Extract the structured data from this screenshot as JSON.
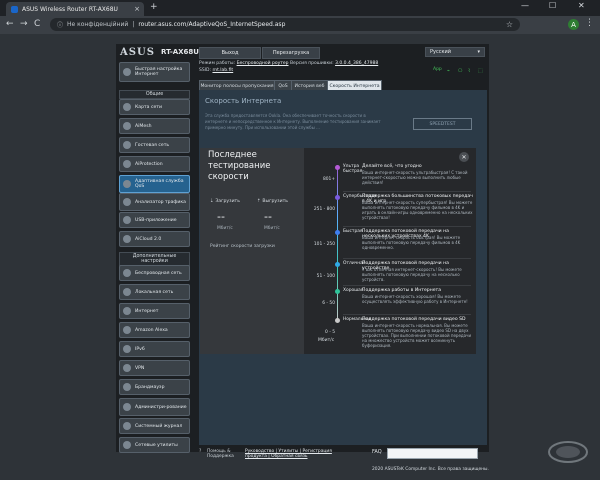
{
  "browser": {
    "tab_title": "ASUS Wireless Router RT-AX68U",
    "tab_close": "×",
    "new_tab": "+",
    "window_controls": [
      "—",
      "☐",
      "✕"
    ],
    "nav_back": "←",
    "nav_forward": "→",
    "nav_reload": "C",
    "not_secure": "Не конфіденційний",
    "url": "router.asus.com/AdaptiveQoS_InternetSpeed.asp",
    "avatar_letter": "A",
    "menu": "⋮"
  },
  "router": {
    "brand": "ASUS",
    "model": "RT-AX68U",
    "logout": "Выход",
    "reboot": "Перезагрузка",
    "language": "Русский",
    "mode_label": "Режим работы:",
    "mode_value": "Беспроводной роутер",
    "fw_label": "Версия прошивки:",
    "fw_value": "3.0.0.4_386_47988",
    "ssid_label": "SSID:",
    "ssid_value": "rnt.lab.fit",
    "app_label": "App"
  },
  "sidebar": {
    "quick_setup": "Быстрая настройка Интернет",
    "general_header": "Общие",
    "general": [
      "Карта сети",
      "AiMesh",
      "Гостевая сеть",
      "AiProtection",
      "Адаптивная служба QoS",
      "Анализатор трафика",
      "USB-приложение",
      "AiCloud 2.0"
    ],
    "advanced_header": "Дополнительные настройки",
    "advanced": [
      "Беспроводная сеть",
      "Локальная сеть",
      "Интернет",
      "Amazon Alexa",
      "IPv6",
      "VPN",
      "Брандмауэр",
      "Администри-рование",
      "Системный журнал",
      "Сетевые утилиты"
    ]
  },
  "tabs": [
    "Монитор полосы пропускания",
    "QoS",
    "История веб",
    "Скорость Интернета"
  ],
  "content": {
    "title": "Скорость Интернета",
    "desc": "Эта служба предоставляется Ookla. Она обеспечивает точность скорости в интернете и непосредственное к Интернету. Выполнение тестирования занимает примерно минуту. При использовании этой службы ...",
    "ookla": "SPEEDTEST"
  },
  "modal": {
    "title": "Последнее тестирование скорости",
    "close": "✕",
    "download_label": "Загрузить",
    "upload_label": "Выгрузить",
    "download_value": "--",
    "upload_value": "--",
    "unit": "Мбит/с",
    "rating": "Рейтинг скорости загрузки",
    "axis_unit": "Мбит/с",
    "levels": [
      {
        "range": "801+",
        "name": "Ультра быстрая",
        "title": "Делайте всё, что угодно",
        "desc": "Ваша интернет-скорость ультрабыстрая! С такой интернет-скоростью можно выполнить любые действия!",
        "color": "#b45ad6"
      },
      {
        "range": "251 - 800",
        "name": "Супербыстрая",
        "title": "Поддержка большинства потоковых передач в 4K и игр",
        "desc": "Ваша интернет-скорость супербыстрая! Вы можете выполнять потоковую передачу фильмов в 4K и играть в онлайн-игры одновременно на нескольких устройствах!",
        "color": "#7b5be0"
      },
      {
        "range": "101 - 250",
        "name": "Быстрая",
        "title": "Поддержка потоковой передачи на нескольких устройствах 4K",
        "desc": "Ваша интернет-скорость быстрая! Вы можете выполнять потоковую передачу фильмов в 4K одновременно.",
        "color": "#3f7ef0"
      },
      {
        "range": "51 - 100",
        "name": "Отличная",
        "title": "Поддержка потоковой передачи на устройстве",
        "desc": "У вас отличная интернет-скорость! Вы можете выполнять потоковую передачу на несколько устройств.",
        "color": "#2fa9e6"
      },
      {
        "range": "6 - 50",
        "name": "Хорошая",
        "title": "Поддержка работы в Интернета",
        "desc": "Ваша интернет-скорость хорошая! Вы можете осуществлять эффективную работу в Интернете!",
        "color": "#2fc49a"
      },
      {
        "range": "0 - 5",
        "name": "Нормальная",
        "title": "Поддержка потоковой передачи видео SD",
        "desc": "Ваша интернет-скорость нормальная. Вы можете выполнять потоковую передачу видео SD на двух устройствах. При выполнении потоковой передачи на множество устройств может возникнуть буферизация.",
        "color": "#c9c9c9"
      }
    ]
  },
  "footer": {
    "help": "Помощь & Поддержка",
    "links": "Руководство | Утилиты | Регистрация продукта | Обратная связь",
    "faq": "FAQ",
    "copyright": "2020 ASUSTeK Computer Inc. Все права защищены."
  },
  "colors": {
    "accent": "#25628f",
    "content_bg": "#2b3a47",
    "modal_bg": "#26282b"
  }
}
